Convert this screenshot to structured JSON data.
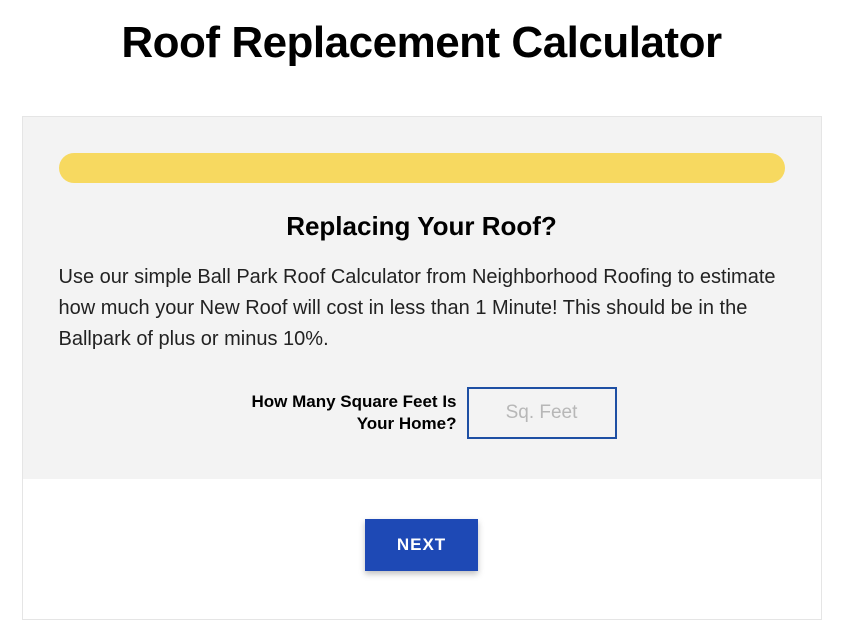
{
  "page": {
    "title": "Roof Replacement Calculator"
  },
  "step": {
    "heading": "Replacing Your Roof?",
    "description": "Use our simple Ball Park Roof Calculator from Neighborhood Roofing to estimate how much your New Roof will cost in less than 1 Minute!  This should be in the Ballpark of plus or minus 10%."
  },
  "form": {
    "sqft_label": "How Many Square Feet Is Your Home?",
    "sqft_placeholder": "Sq. Feet",
    "sqft_value": ""
  },
  "actions": {
    "next_label": "NEXT"
  },
  "colors": {
    "progress": "#f7d960",
    "accent": "#1e49b5",
    "input_border": "#1e4fa3"
  }
}
